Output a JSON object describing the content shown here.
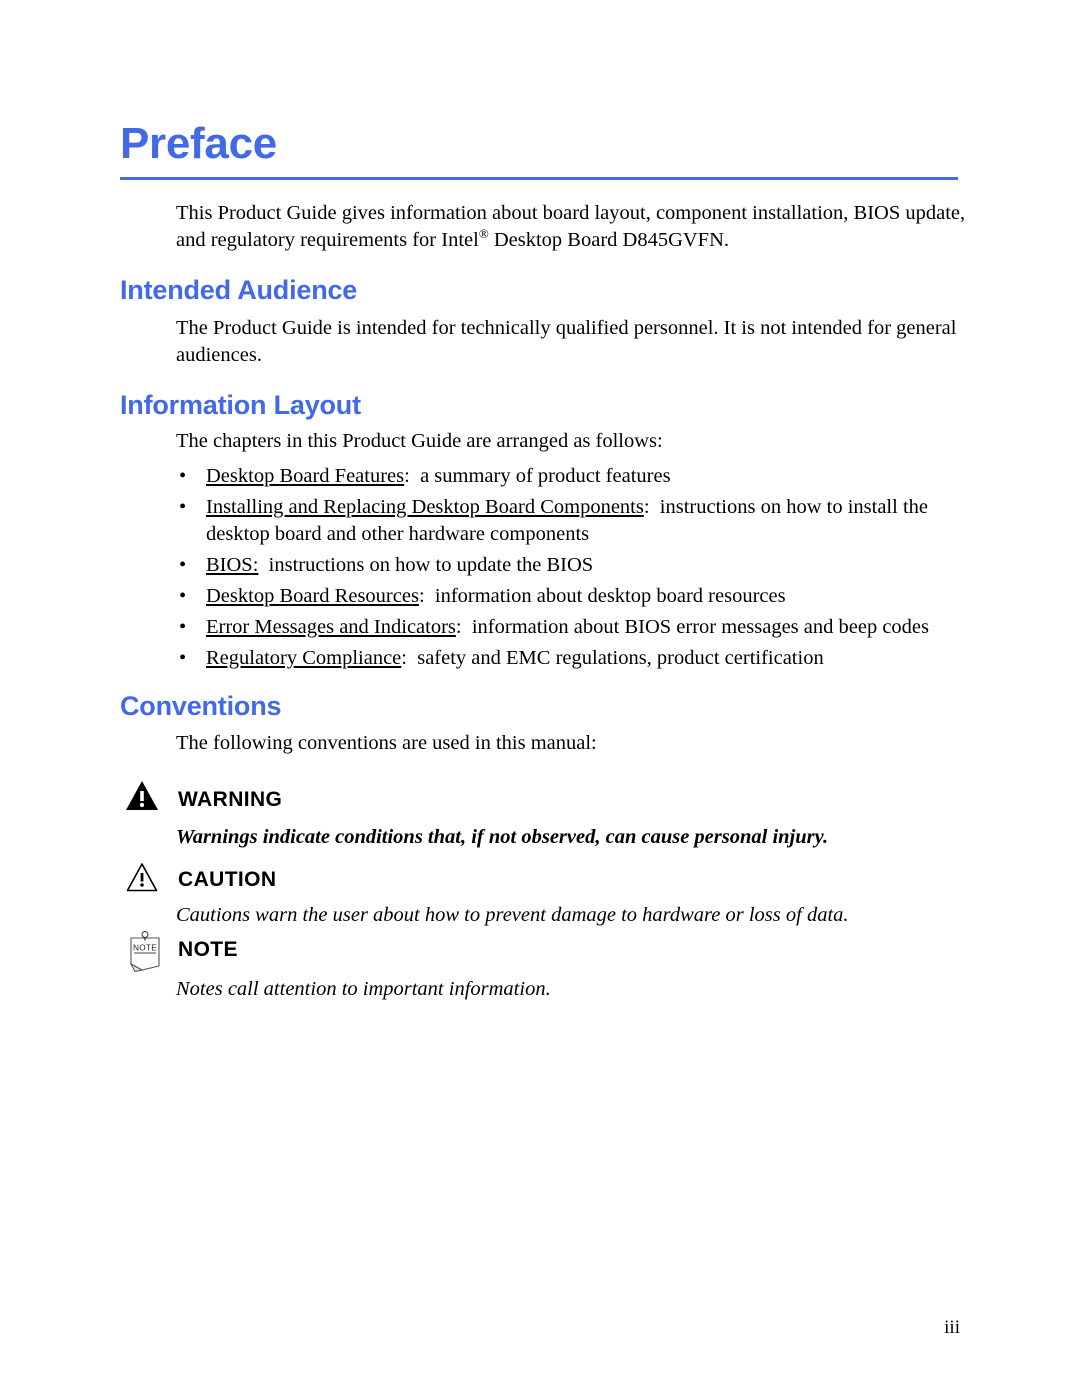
{
  "document": {
    "title": "Preface",
    "intro_paragraph": "This Product Guide gives information about board layout, component installation, BIOS update, and regulatory requirements for Intel",
    "intro_paragraph_part1": "This Product Guide gives information about board layout, component installation, BIOS update, and regulatory requirements for Intel",
    "registered_mark": "®",
    "intro_paragraph_part2": " Desktop Board D845GVFN.",
    "accent_color": "#4169e8",
    "text_color": "#000000",
    "page_background": "#ffffff"
  },
  "sections": {
    "intended_audience": {
      "heading": "Intended Audience",
      "paragraph": "The Product Guide is intended for technically qualified personnel.  It is not intended for general audiences."
    },
    "information_layout": {
      "heading": "Information Layout",
      "paragraph": "The chapters in this Product Guide are arranged as follows:",
      "bullet_marker": "•",
      "items": [
        {
          "lead": "Desktop Board Features",
          "separator": ":  ",
          "description": "a summary of product features"
        },
        {
          "lead": "Installing and Replacing Desktop Board Components",
          "separator": ":  ",
          "description": "instructions on how to install the desktop board and other hardware components"
        },
        {
          "lead": "BIOS:",
          "separator": "  ",
          "description": "instructions on how to update the BIOS"
        },
        {
          "lead": "Desktop Board Resources",
          "separator": ":  ",
          "description": "information about desktop board resources"
        },
        {
          "lead": "Error Messages and Indicators",
          "separator": ":  ",
          "description": "information about BIOS error messages and beep codes"
        },
        {
          "lead": "Regulatory Compliance",
          "separator": ":  ",
          "description": "safety and EMC regulations, product certification"
        }
      ]
    },
    "conventions": {
      "heading": "Conventions",
      "paragraph": "The following conventions are used in this manual:",
      "blocks": [
        {
          "icon": "warning-triangle-icon",
          "label": "WARNING",
          "text": "Warnings indicate conditions that, if not observed, can cause personal injury."
        },
        {
          "icon": "caution-triangle-icon",
          "label": "CAUTION",
          "text": "Cautions warn the user about how to prevent damage to hardware or loss of data."
        },
        {
          "icon": "note-page-icon",
          "label": "NOTE",
          "text": "Notes call attention to important information.",
          "icon_caption": "NOTE"
        }
      ]
    }
  },
  "footer": {
    "page_number": "iii"
  }
}
